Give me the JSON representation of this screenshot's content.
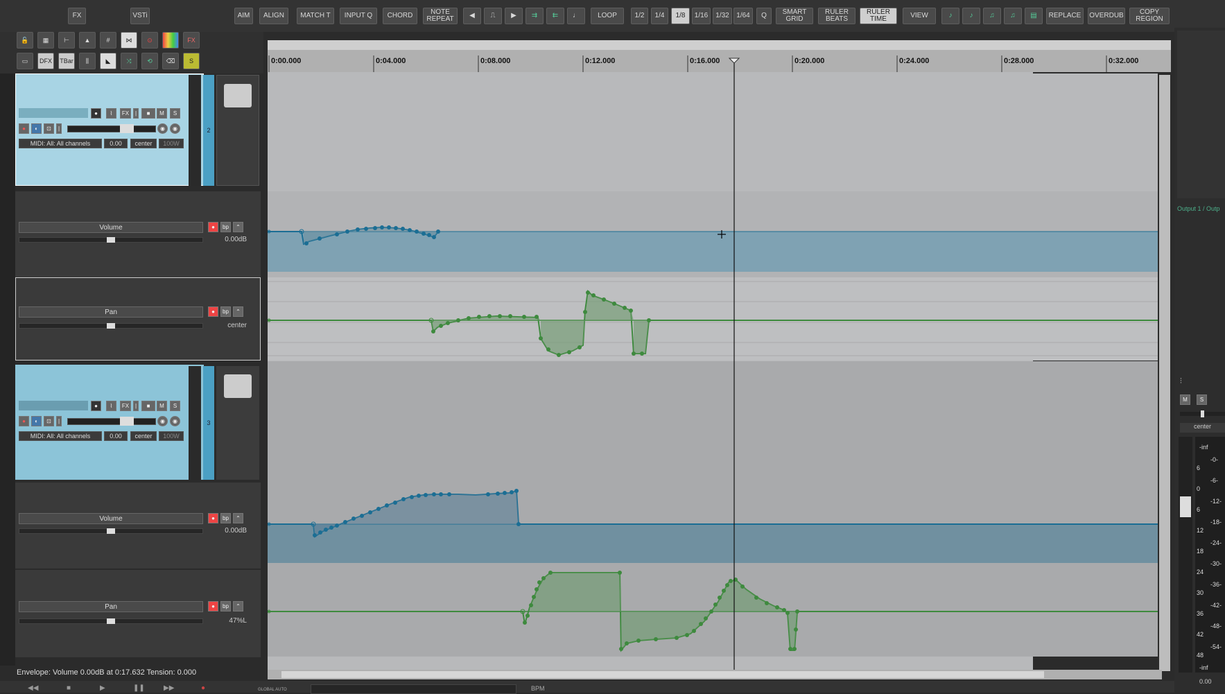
{
  "toolbar": {
    "fx": "FX",
    "vsti": "VSTi",
    "aim": "AIM",
    "align": "ALIGN",
    "match_t": "MATCH T",
    "input_q": "INPUT Q",
    "chord": "CHORD",
    "note_repeat": "NOTE REPEAT",
    "loop": "LOOP",
    "grid_half": "1/2",
    "grid_quarter": "1/4",
    "grid_eighth": "1/8",
    "grid_16": "1/16",
    "grid_32": "1/32",
    "grid_64": "1/64",
    "q": "Q",
    "smart_grid": "SMART GRID",
    "ruler_beats": "RULER BEATS",
    "ruler_time": "RULER TIME",
    "view": "VIEW",
    "replace": "REPLACE",
    "overdub": "OVERDUB",
    "copy_region": "COPY REGION"
  },
  "tool_icons": {
    "fx_small": "FX",
    "dfx": "DFX",
    "tbar": "TBar",
    "s": "S"
  },
  "ruler": [
    "0:00.000",
    "0:04.000",
    "0:08.000",
    "0:12.000",
    "0:16.000",
    "0:20.000",
    "0:24.000",
    "0:28.000",
    "0:32.000"
  ],
  "tracks": [
    {
      "number": "2",
      "midi_input": "MIDI: All: All channels",
      "volume": "0.00",
      "pan": "center",
      "width": "100W",
      "fx": "FX",
      "mute": "M",
      "solo": "S",
      "envelopes": [
        {
          "name": "Volume",
          "value": "0.00dB",
          "bp": "bp"
        },
        {
          "name": "Pan",
          "value": "center",
          "bp": "bp"
        }
      ]
    },
    {
      "number": "3",
      "midi_input": "MIDI: All: All channels",
      "volume": "0.00",
      "pan": "center",
      "width": "100W",
      "fx": "FX",
      "mute": "M",
      "solo": "S",
      "envelopes": [
        {
          "name": "Volume",
          "value": "0.00dB",
          "bp": "bp"
        },
        {
          "name": "Pan",
          "value": "47%L",
          "bp": "bp"
        }
      ]
    }
  ],
  "status": "Envelope: Volume 0.00dB at 0:17.632 Tension: 0.000",
  "transport": {
    "bpm": "BPM",
    "global_auto": "GLOBAL AUTO"
  },
  "mixer": {
    "output_label": "Output 1 / Outp",
    "m": "M",
    "s": "S",
    "pan": "center",
    "inf_top": "-inf",
    "inf_bottom": "-inf",
    "value": "0.00",
    "scale_left": [
      "6",
      "0",
      "6",
      "12",
      "18",
      "24",
      "30",
      "36",
      "42",
      "48"
    ],
    "scale_right": [
      "-0-",
      "-6-",
      "-12-",
      "-18-",
      "-24-",
      "-30-",
      "-36-",
      "-42-",
      "-48-",
      "-54-"
    ]
  },
  "colors": {
    "volume_env": "#1b6e94",
    "pan_env": "#3e8a3e",
    "track_selected": "#a8d4e4",
    "track_blue": "#8cc4d8"
  }
}
